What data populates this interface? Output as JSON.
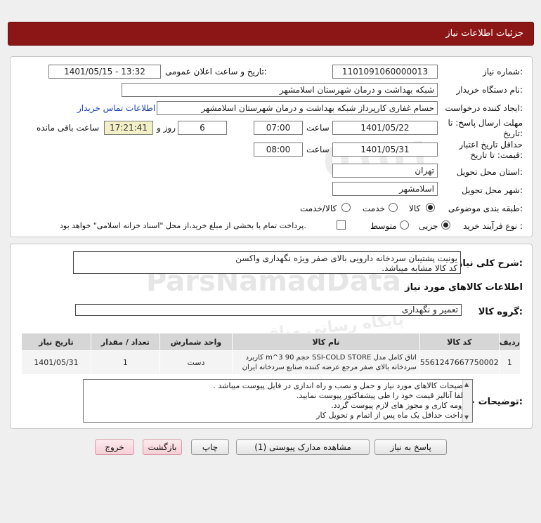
{
  "header": {
    "title": "جزئیات اطلاعات نیاز"
  },
  "form": {
    "need_number_label": "شماره نیاز:",
    "need_number": "1101091060000013",
    "announce_label": "تاریخ و ساعت اعلان عمومی:",
    "announce_value": "1401/05/15 - 13:32",
    "buyer_org_label": "نام دستگاه خریدار:",
    "buyer_org": "شبکه بهداشت و درمان شهرستان اسلامشهر",
    "creator_label": "ایجاد کننده درخواست:",
    "creator": "حسام غفاری کارپرداز شبکه بهداشت و درمان شهرستان اسلامشهر",
    "contact_link": "اطلاعات تماس خریدار",
    "deadline_label_1": "مهلت ارسال پاسخ: تا",
    "deadline_label_2": "تاریخ:",
    "deadline_date": "1401/05/22",
    "time_label": "ساعت",
    "deadline_time": "07:00",
    "days_value": "6",
    "days_label": "روز و",
    "remaining_time": "17:21:41",
    "remaining_label": "ساعت باقی مانده",
    "validity_label_1": "حداقل تاریخ اعتبار",
    "validity_label_2": "قیمت: تا تاریخ:",
    "validity_date": "1401/05/31",
    "validity_time_label": "ساعت",
    "validity_time": "08:00",
    "province_label": "استان محل تحویل:",
    "province": "تهران",
    "city_label": "شهر محل تحویل:",
    "city": "اسلامشهر",
    "category_label": "طبقه بندی موضوعی:",
    "category_options": [
      "کالا",
      "خدمت",
      "کالا/خدمت"
    ],
    "category_selected": "کالا",
    "process_label": "نوع فرآیند خرید :",
    "process_options": [
      "جزیی",
      "متوسط"
    ],
    "process_selected": "جزیی",
    "payment_note": "پرداخت تمام یا بخشی از مبلغ خرید،از محل \"اسناد خزانه اسلامی\" خواهد بود."
  },
  "details": {
    "summary_label": "شرح کلی نیاز:",
    "summary_text": "یونیت پشتیبان  سردخانه دارویی بالای صفر ویژه نگهداری واکسن\nکد کالا مشابه میباشد.",
    "goods_info_title": "اطلاعات کالاهای مورد نیاز",
    "goods_group_label": "گروه کالا:",
    "goods_group": "تعمیر و نگهداری",
    "table": {
      "headers": [
        "ردیف",
        "کد کالا",
        "نام کالا",
        "واحد شمارش",
        "تعداد / مقدار",
        "تاریخ نیاز"
      ],
      "rows": [
        {
          "row": "1",
          "code": "5561247667750002",
          "name": "اتاق کامل مدل SSI-COLD STORE حجم m^3 90 کاربرد سردخانه بالای صفر مرجع عرضه کننده صنایع سردخانه ایران",
          "unit": "دست",
          "qty": "1",
          "date": "1401/05/31"
        }
      ]
    },
    "buyer_notes_label": "توضیحات خریدار:",
    "buyer_notes": "توضیحات کالاهای مورد نیاز و حمل و نصب و راه اندازی در فایل پیوست میباشد .\nلطفا آنالیز قیمت خود را طی پیشفاکتور پیوست نمایید.\nزرومه کاری و مجوز های لازم پیوست گردد.\nپرداخت حداقل یک ماه پس از اتمام و تحویل کار"
  },
  "buttons": {
    "reply": "پاسخ به نیاز",
    "view_docs": "مشاهده مدارک پیوستی (1)",
    "print": "چاپ",
    "back": "بازگشت",
    "exit": "خروج"
  }
}
